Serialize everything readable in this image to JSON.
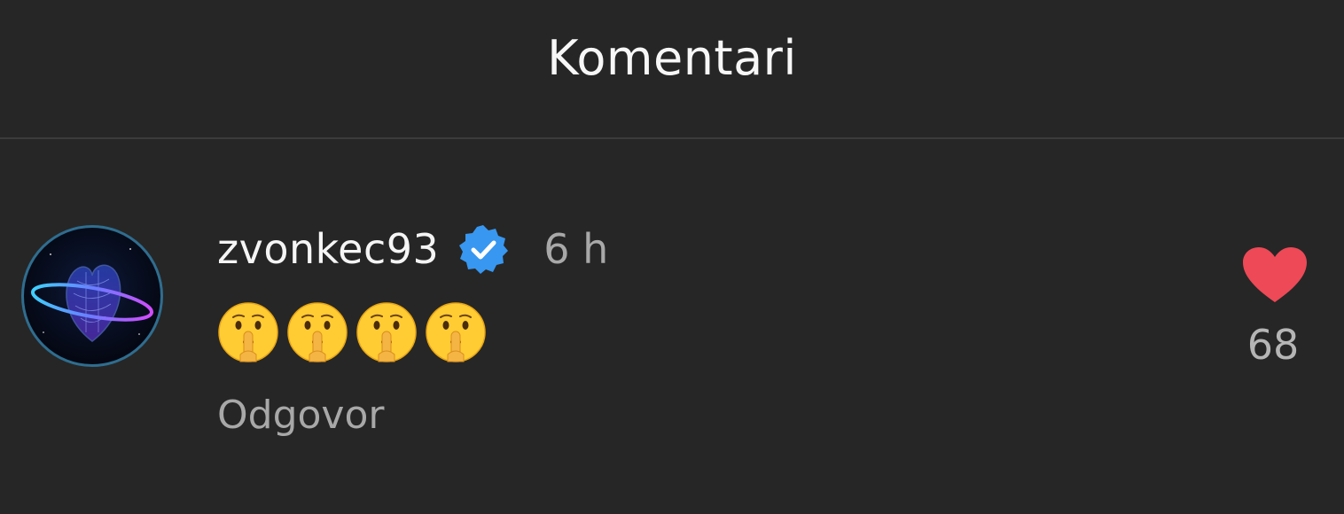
{
  "header": {
    "title": "Komentari"
  },
  "comment": {
    "username": "zvonkec93",
    "verified": true,
    "timestamp": "6 h",
    "emoji_text": "🤫🤫🤫🤫",
    "emoji_icons": [
      "shushing-face",
      "shushing-face",
      "shushing-face",
      "shushing-face"
    ],
    "reply_label": "Odgovor",
    "like_count": "68",
    "liked": true
  },
  "colors": {
    "background": "#262626",
    "verified_badge": "#3897f0",
    "like_heart": "#ed4956",
    "secondary_text": "#a8a8a8"
  }
}
